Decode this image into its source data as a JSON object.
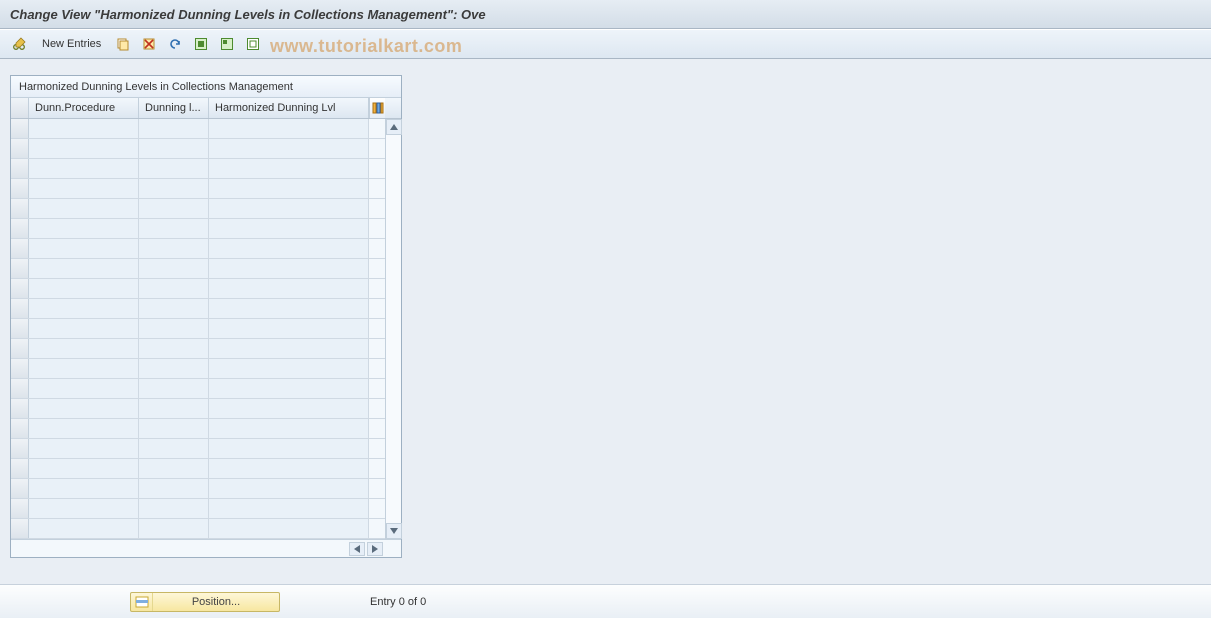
{
  "title": "Change View \"Harmonized Dunning Levels in Collections Management\": Ove",
  "toolbar": {
    "new_entries_label": "New Entries"
  },
  "watermark": "www.tutorialkart.com",
  "grid": {
    "title": "Harmonized Dunning Levels in Collections Management",
    "columns": {
      "c1": "Dunn.Procedure",
      "c2": "Dunning l...",
      "c3": "Harmonized Dunning Lvl"
    },
    "row_count": 21
  },
  "footer": {
    "position_label": "Position...",
    "entry_text": "Entry 0 of 0"
  }
}
